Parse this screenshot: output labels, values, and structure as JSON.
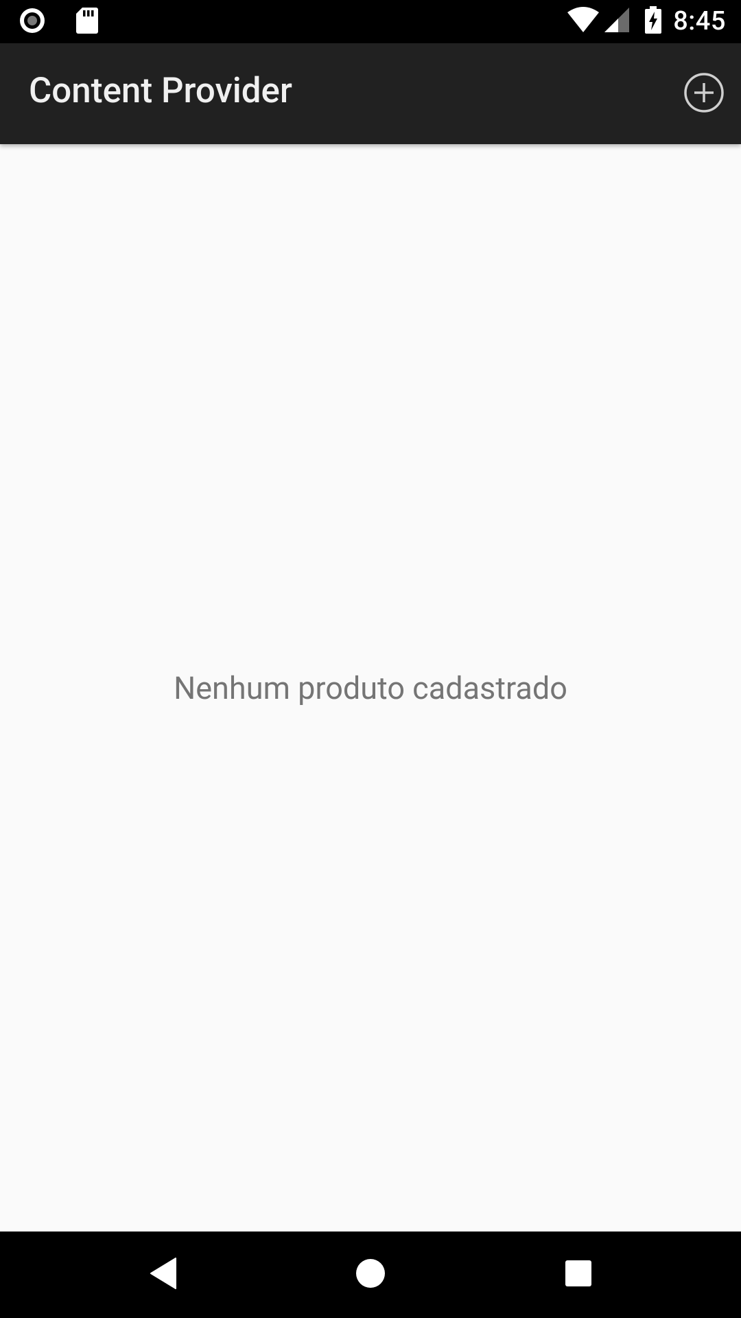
{
  "status_bar": {
    "time": "8:45",
    "icons": [
      "screen-record-icon",
      "sd-card-icon",
      "wifi-icon",
      "signal-icon",
      "battery-charging-icon"
    ]
  },
  "app_bar": {
    "title": "Content Provider",
    "action_icon": "add-circle-icon"
  },
  "content": {
    "empty_message": "Nenhum produto cadastrado"
  },
  "nav_bar": {
    "icons": [
      "back-icon",
      "home-icon",
      "recents-icon"
    ]
  },
  "colors": {
    "status_bar": "#000000",
    "app_bar": "#212121",
    "background": "#fafafa",
    "empty_text": "#757575",
    "nav_bar": "#000000"
  }
}
